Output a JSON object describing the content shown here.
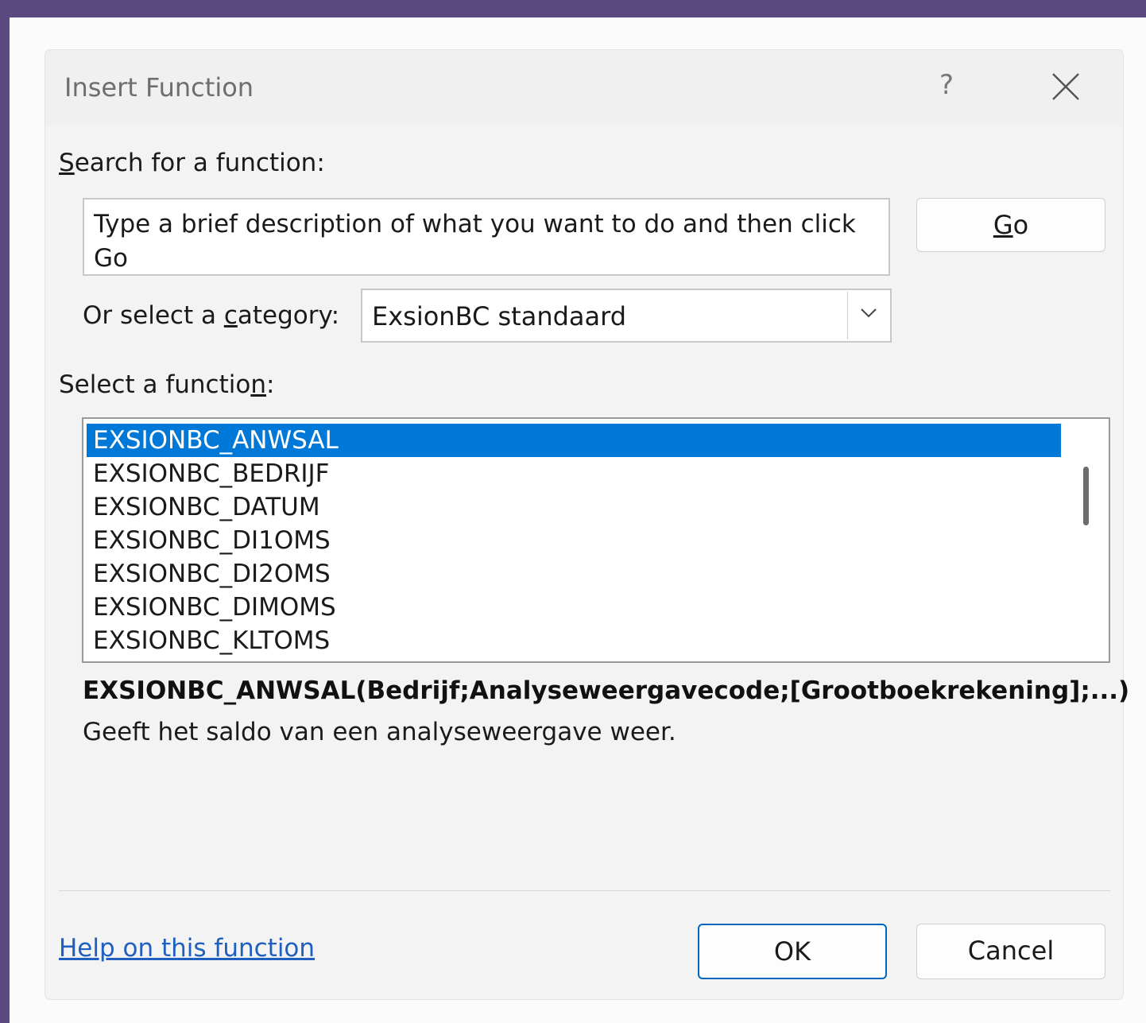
{
  "dialog": {
    "title": "Insert Function",
    "help_glyph": "?",
    "close_icon": "close-icon"
  },
  "search": {
    "label_first": "S",
    "label_rest": "earch for a function:",
    "value": "Type a brief description of what you want to do and then click Go",
    "go_first": "G",
    "go_rest": "o"
  },
  "category": {
    "label_before": "Or select a ",
    "label_key": "c",
    "label_after": "ategory:",
    "selected": "ExsionBC standaard",
    "arrow_icon": "chevron-down-icon"
  },
  "function_list": {
    "label_before": "Select a functio",
    "label_key": "n",
    "label_after": ":",
    "items": [
      "EXSIONBC_ANWSAL",
      "EXSIONBC_BEDRIJF",
      "EXSIONBC_DATUM",
      "EXSIONBC_DI1OMS",
      "EXSIONBC_DI2OMS",
      "EXSIONBC_DIMOMS",
      "EXSIONBC_KLTOMS"
    ],
    "selected_index": 0,
    "selected_color": "#0078d7"
  },
  "details": {
    "signature": "EXSIONBC_ANWSAL(Bedrijf;Analyseweergavecode;[Grootboekrekening];...)",
    "description": "Geeft het saldo van een analyseweergave weer."
  },
  "footer": {
    "help_link": "Help on this function",
    "ok_label": "OK",
    "cancel_label": "Cancel"
  }
}
